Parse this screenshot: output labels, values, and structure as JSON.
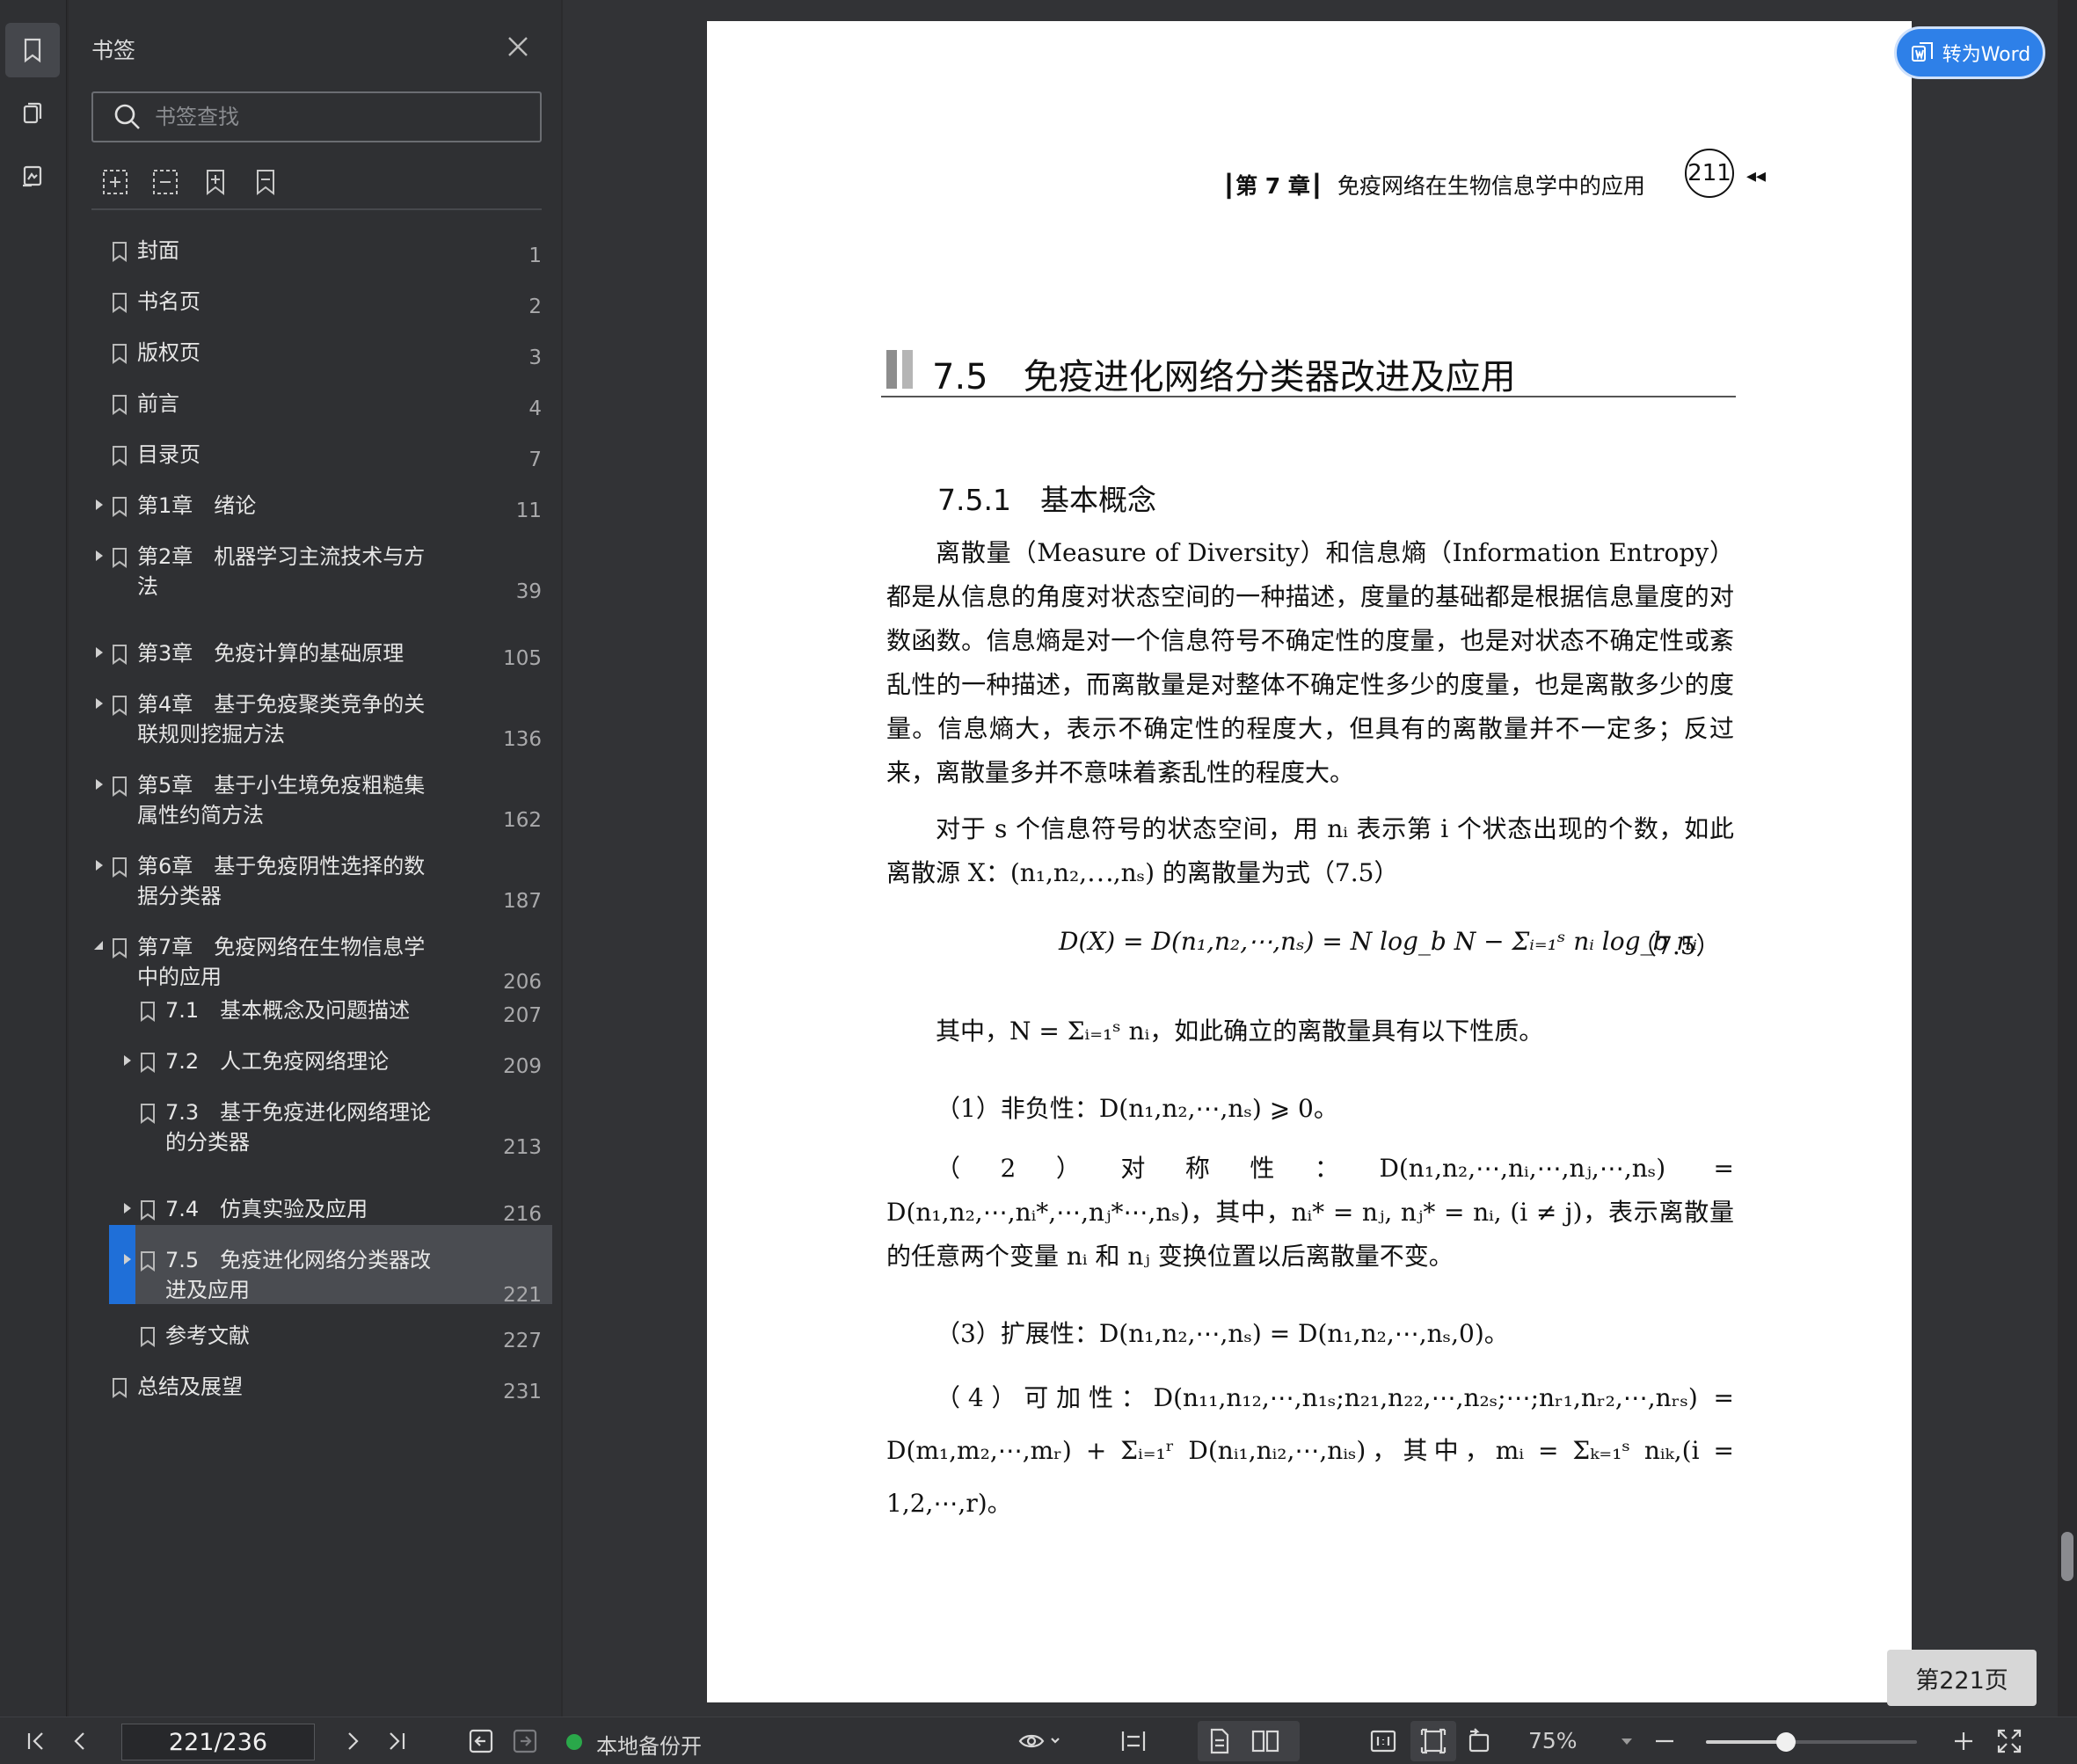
{
  "panel": {
    "title": "书签",
    "search_placeholder": "书签查找",
    "tools": [
      "expand-all-icon",
      "collapse-all-icon",
      "add-bookmark-icon",
      "bookmark-icon"
    ]
  },
  "bookmarks": [
    {
      "label": "封面",
      "page": "1",
      "level": 0,
      "expandable": false
    },
    {
      "label": "书名页",
      "page": "2",
      "level": 0,
      "expandable": false
    },
    {
      "label": "版权页",
      "page": "3",
      "level": 0,
      "expandable": false
    },
    {
      "label": "前言",
      "page": "4",
      "level": 0,
      "expandable": false
    },
    {
      "label": "目录页",
      "page": "7",
      "level": 0,
      "expandable": false
    },
    {
      "label": "第1章　绪论",
      "page": "11",
      "level": 0,
      "expandable": true,
      "expanded": false
    },
    {
      "label": "第2章　机器学习主流技术与方\n法",
      "page": "39",
      "level": 0,
      "expandable": true,
      "expanded": false
    },
    {
      "label": "第3章　免疫计算的基础原理",
      "page": "105",
      "level": 0,
      "expandable": true,
      "expanded": false
    },
    {
      "label": "第4章　基于免疫聚类竞争的关\n联规则挖掘方法",
      "page": "136",
      "level": 0,
      "expandable": true,
      "expanded": false
    },
    {
      "label": "第5章　基于小生境免疫粗糙集\n属性约简方法",
      "page": "162",
      "level": 0,
      "expandable": true,
      "expanded": false
    },
    {
      "label": "第6章　基于免疫阴性选择的数\n据分类器",
      "page": "187",
      "level": 0,
      "expandable": true,
      "expanded": false
    },
    {
      "label": "第7章　免疫网络在生物信息学\n中的应用",
      "page": "206",
      "level": 0,
      "expandable": true,
      "expanded": true
    },
    {
      "label": "7.1　基本概念及问题描述",
      "page": "207",
      "level": 1,
      "expandable": false
    },
    {
      "label": "7.2　人工免疫网络理论",
      "page": "209",
      "level": 1,
      "expandable": true,
      "expanded": false
    },
    {
      "label": "7.3　基于免疫进化网络理论\n的分类器",
      "page": "213",
      "level": 1,
      "expandable": false
    },
    {
      "label": "7.4　仿真实验及应用",
      "page": "216",
      "level": 1,
      "expandable": true,
      "expanded": false
    },
    {
      "label": "7.5　免疫进化网络分类器改\n进及应用",
      "page": "221",
      "level": 1,
      "expandable": true,
      "expanded": false,
      "selected": true
    },
    {
      "label": "参考文献",
      "page": "227",
      "level": 1,
      "expandable": false
    },
    {
      "label": "总结及展望",
      "page": "231",
      "level": 0,
      "expandable": false
    }
  ],
  "document": {
    "running_head_chapter": "第 7 章",
    "running_head_title": "免疫网络在生物信息学中的应用",
    "printed_page": "211",
    "running_head_arrows": "◂◂",
    "section_title": "7.5　免疫进化网络分类器改进及应用",
    "subsection_title": "7.5.1　基本概念",
    "para1": "离散量（Measure of Diversity）和信息熵（Information Entropy）都是从信息的角度对状态空间的一种描述，度量的基础都是根据信息量度的对数函数。信息熵是对一个信息符号不确定性的度量，也是对状态不确定性或紊乱性的一种描述，而离散量是对整体不确定性多少的度量，也是离散多少的度量。信息熵大，表示不确定性的程度大，但具有的离散量并不一定多；反过来，离散量多并不意味着紊乱性的程度大。",
    "para2": "对于 s 个信息符号的状态空间，用 nᵢ 表示第 i 个状态出现的个数，如此离散源 X：(n₁,n₂,⋯,nₛ) 的离散量为式（7.5）",
    "eq75": "D(X) = D(n₁,n₂,⋯,nₛ) = N log_b N − Σᵢ₌₁ˢ nᵢ log_b nᵢ",
    "eq75_num": "（7.5）",
    "para3": "其中，N = Σᵢ₌₁ˢ nᵢ，如此确立的离散量具有以下性质。",
    "prop1": "（1）非负性：D(n₁,n₂,⋯,nₛ) ⩾ 0。",
    "prop2": "（2）对称性：D(n₁,n₂,⋯,nᵢ,⋯,nⱼ,⋯,nₛ) = D(n₁,n₂,⋯,nᵢ*,⋯,nⱼ*⋯,nₛ)，其中，nᵢ* = nⱼ, nⱼ* = nᵢ, (i ≠ j)，表示离散量的任意两个变量 nᵢ 和 nⱼ 变换位置以后离散量不变。",
    "prop3": "（3）扩展性：D(n₁,n₂,⋯,nₛ) = D(n₁,n₂,⋯,nₛ,0)。",
    "prop4": "（4）可加性：D(n₁₁,n₁₂,⋯,n₁ₛ;n₂₁,n₂₂,⋯,n₂ₛ;⋯;nᵣ₁,nᵣ₂,⋯,nᵣₛ) = D(m₁,m₂,⋯,mᵣ) + Σᵢ₌₁ʳ D(nᵢ₁,nᵢ₂,⋯,nᵢₛ)，其中，mᵢ = Σₖ₌₁ˢ nᵢₖ,(i = 1,2,⋯,r)。"
  },
  "toword_label": "转为Word",
  "page_badge": "第221页",
  "status": {
    "page_field": "221/236",
    "backup_text": "本地备份开",
    "zoom": "75%",
    "zoom_fraction": 0.38
  },
  "colors": {
    "accent": "#2e80e8",
    "selected": "#1f6fd8",
    "backup_on": "#2aa84a"
  }
}
